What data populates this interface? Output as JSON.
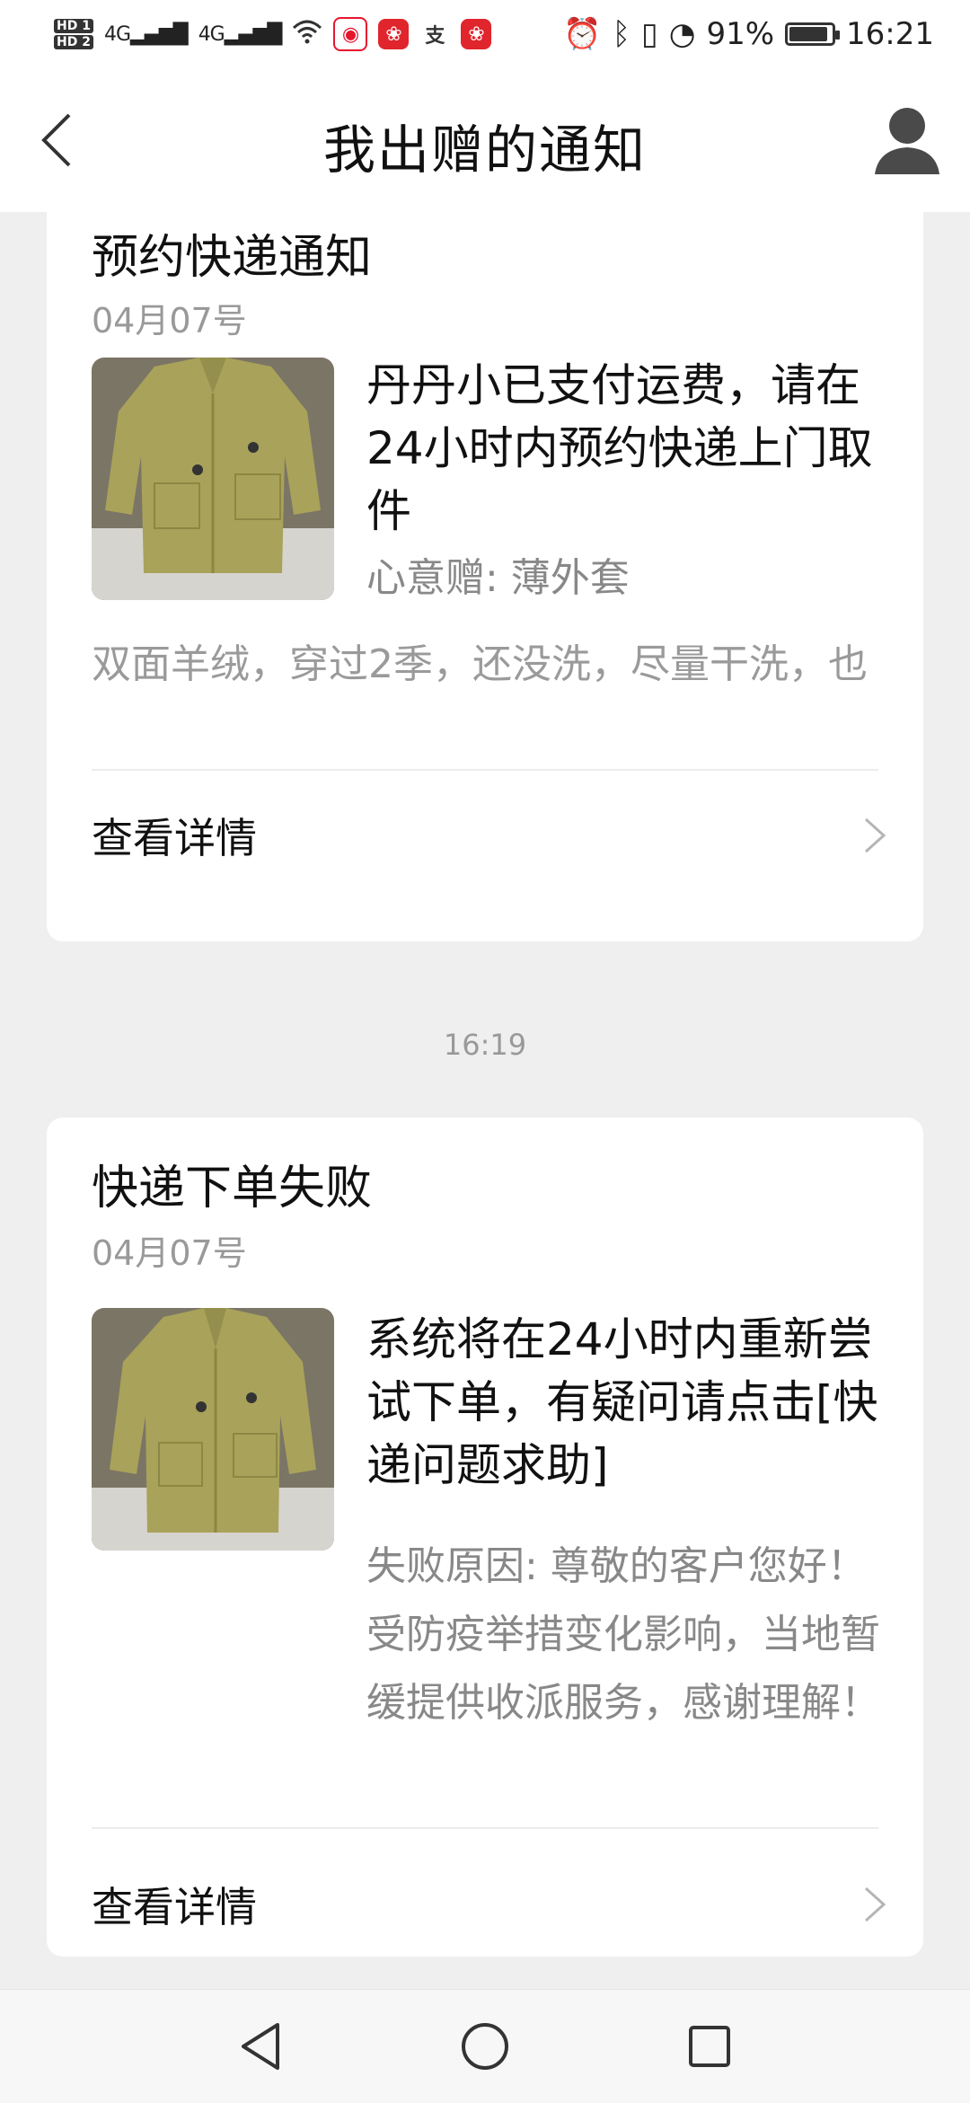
{
  "status_bar": {
    "hd1": "HD 1",
    "hd2": "HD 2",
    "signal1": "4G",
    "signal2": "4G",
    "battery_text": "91%",
    "battery_level": 0.91,
    "time": "16:21",
    "app_icons": [
      "weibo-icon",
      "app-red-icon",
      "alipay-icon",
      "app-red-icon"
    ]
  },
  "header": {
    "title": "我出赠的通知"
  },
  "cards": [
    {
      "title": "预约快递通知",
      "date": "04月07号",
      "message": "丹丹小已支付运费，请在24小时内预约快递上门取件",
      "subline": "心意赠: 薄外套",
      "description": "双面羊绒，穿过2季，还没洗，尽量干洗，也",
      "detail_label": "查看详情"
    },
    {
      "title": "快递下单失败",
      "date": "04月07号",
      "message": "系统将在24小时内重新尝试下单，有疑问请点击[快递问题求助]",
      "subline": "失败原因: 尊敬的客户您好！受防疫举措变化影响，当地暂缓提供收派服务，感谢理解！",
      "detail_label": "查看详情"
    }
  ],
  "timestamp_between": "16:19",
  "colors": {
    "background": "#efefef",
    "card": "#ffffff",
    "muted_text": "#999999",
    "coat": "#a9a25a"
  }
}
